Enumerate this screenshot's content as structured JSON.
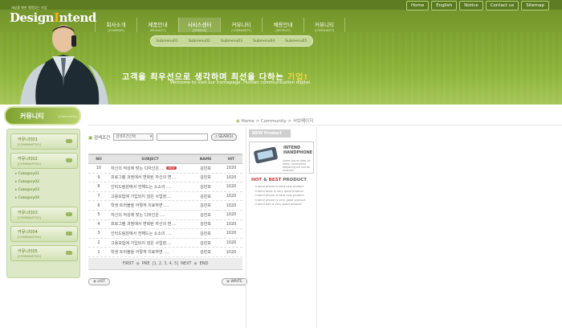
{
  "top_links": [
    "Home",
    "English",
    "Notice",
    "Contact us",
    "Sitemap"
  ],
  "logo": {
    "subtitle": "세상을 향한 열정있는 기업",
    "text_pre": "Design",
    "text_hi": "I",
    "text_post": "ntend"
  },
  "nav": [
    {
      "kr": "회사소개",
      "en": "[COMPANY]",
      "active": false
    },
    {
      "kr": "제품안내",
      "en": "[PRODUCT]",
      "active": false
    },
    {
      "kr": "서비스센터",
      "en": "[SERVICE]",
      "active": true
    },
    {
      "kr": "커뮤니티",
      "en": "[COMMUNITY]",
      "active": false
    },
    {
      "kr": "채용안내",
      "en": "[RECRUIT]",
      "active": false
    },
    {
      "kr": "커뮤니티",
      "en": "[COMMUNITY]",
      "active": false
    }
  ],
  "subnav": [
    "Submenu01",
    "Submenu02",
    "Submenu03",
    "Submenu04",
    "Submenu05"
  ],
  "slogan": {
    "kr_white": "고객을 최우선으로 생각하며 최선을 다하는 ",
    "kr_yellow": "기업!",
    "en": "Welcome to visit our homepage. Human communication digital."
  },
  "sidebar": {
    "title_kr": "커뮤니티",
    "title_en": "[Community]",
    "items": [
      {
        "kr": "커뮤니티01",
        "en": "[COMMUNITY01]"
      },
      {
        "kr": "커뮤니티02",
        "en": "[COMMUNITY02]"
      },
      {
        "kr": "커뮤니티03",
        "en": "[COMMUNITY03]"
      },
      {
        "kr": "커뮤니티04",
        "en": "[COMMUNITY04]"
      },
      {
        "kr": "커뮤니티05",
        "en": "[COMMUNITY05]"
      }
    ],
    "subitems": [
      "Category01",
      "Category02",
      "Category03",
      "Category04"
    ]
  },
  "breadcrumb": {
    "home": "Home",
    "sep1": ">",
    "community": "Community",
    "sep2": ">",
    "current": "서브페이지"
  },
  "search": {
    "label": "검색조건",
    "select_value": "검색조건선택",
    "input_value": "",
    "button": "SEARCH"
  },
  "board": {
    "headers": {
      "no": "NO",
      "subject": "SUBJECT",
      "name": "NAME",
      "hit": "HIT"
    },
    "rows": [
      {
        "no": "10",
        "subject": "자신의 적성에 맞는 디자인은....",
        "new": "NEW",
        "name": "김민보",
        "hit": "1020"
      },
      {
        "no": "9",
        "subject": "프로그램 과정에서 변화된 자신의 변....",
        "new": "",
        "name": "김민보",
        "hit": "1020"
      },
      {
        "no": "8",
        "subject": "인터드림원에서 전해드는 소소의 ....",
        "new": "",
        "name": "김민보",
        "hit": "1020"
      },
      {
        "no": "7",
        "subject": "고용보험에 가입되지 않은 사업장....",
        "new": "",
        "name": "김민보",
        "hit": "1020"
      },
      {
        "no": "6",
        "subject": "학생 트러블을 어떻게 치료하면 ....",
        "new": "",
        "name": "김민보",
        "hit": "1020"
      },
      {
        "no": "5",
        "subject": "자신의 적성에 맞는 디자인은 ....",
        "new": "",
        "name": "김민보",
        "hit": "1020"
      },
      {
        "no": "4",
        "subject": "프로그램 과정에서 변화된 자신의 변....",
        "new": "",
        "name": "김민보",
        "hit": "1020"
      },
      {
        "no": "3",
        "subject": "인터드림원에서 전해드는 소소의 ....",
        "new": "",
        "name": "김민보",
        "hit": "1020"
      },
      {
        "no": "2",
        "subject": "고용보험에 가입되지 않은 사업장....",
        "new": "",
        "name": "김민보",
        "hit": "1020"
      },
      {
        "no": "1",
        "subject": "학생 트러블을 어떻게 치료하면 ....",
        "new": "",
        "name": "김민보",
        "hit": "1020"
      }
    ],
    "pager": {
      "first": "FIRST",
      "pre": "PRE",
      "pages": "[1, 2, 3, 4, 5]",
      "next": "NEXT",
      "end": "END"
    },
    "list_button": "LIST",
    "write_button": "WRITE"
  },
  "right_panel": {
    "new_product_tab": "NEW Product",
    "product_title_1": "INTEND",
    "product_title_2": "HANDPHONE",
    "product_desc": "Lorem ipsum dolor sit amet, consectetur adipiscing elit sed do eiusmod",
    "hot_title_1": "HOT",
    "hot_amp": " & ",
    "hot_title_2": "BEST",
    "hot_title_3": " PRODUCT",
    "hot_items": [
      "Intend phone is best new product",
      "Intend book is very good product",
      "Intend phone is best new product",
      "Intend phone is very good product",
      "Intend bell is very good product"
    ]
  },
  "colors": {
    "header_green": "#7fa330",
    "accent_red": "#c43737",
    "side_green": "#dce8c6"
  }
}
